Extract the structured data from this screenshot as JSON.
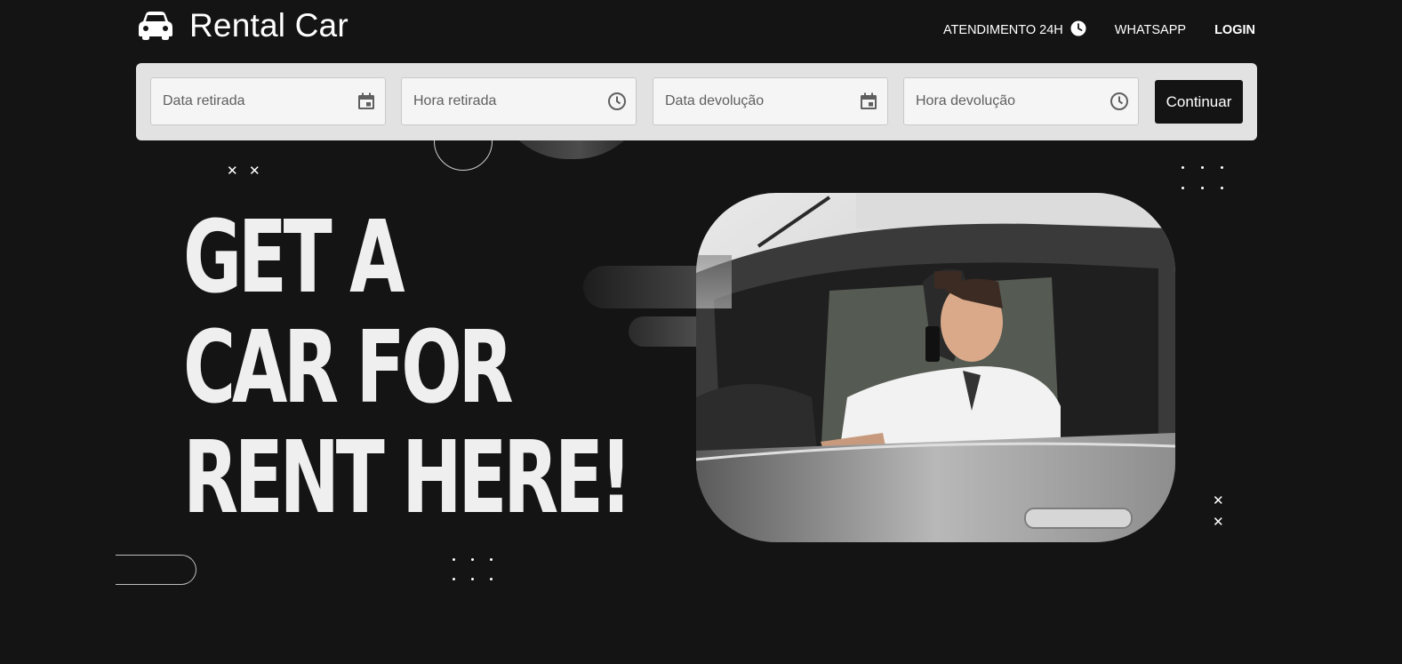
{
  "brand": {
    "name": "Rental Car",
    "icon": "car-icon"
  },
  "nav": {
    "support": {
      "label": "ATENDIMENTO 24H",
      "icon": "clock-icon"
    },
    "whatsapp": {
      "label": "WHATSAPP"
    },
    "login": {
      "label": "LOGIN"
    }
  },
  "booking": {
    "fields": [
      {
        "placeholder": "Data retirada",
        "icon": "calendar-icon"
      },
      {
        "placeholder": "Hora retirada",
        "icon": "clock-icon"
      },
      {
        "placeholder": "Data devolução",
        "icon": "calendar-icon"
      },
      {
        "placeholder": "Hora devolução",
        "icon": "clock-icon"
      }
    ],
    "submit_label": "Continuar"
  },
  "hero": {
    "headline": [
      "GET A",
      "CAR FOR",
      "RENT HERE!"
    ],
    "image": "photo of man in white shirt talking on phone while driving a grey car"
  },
  "colors": {
    "background": "#141414",
    "booking_bar": "#e2e2e2",
    "field": "#f5f5f5",
    "button": "#141414",
    "text_light": "#efefef"
  }
}
